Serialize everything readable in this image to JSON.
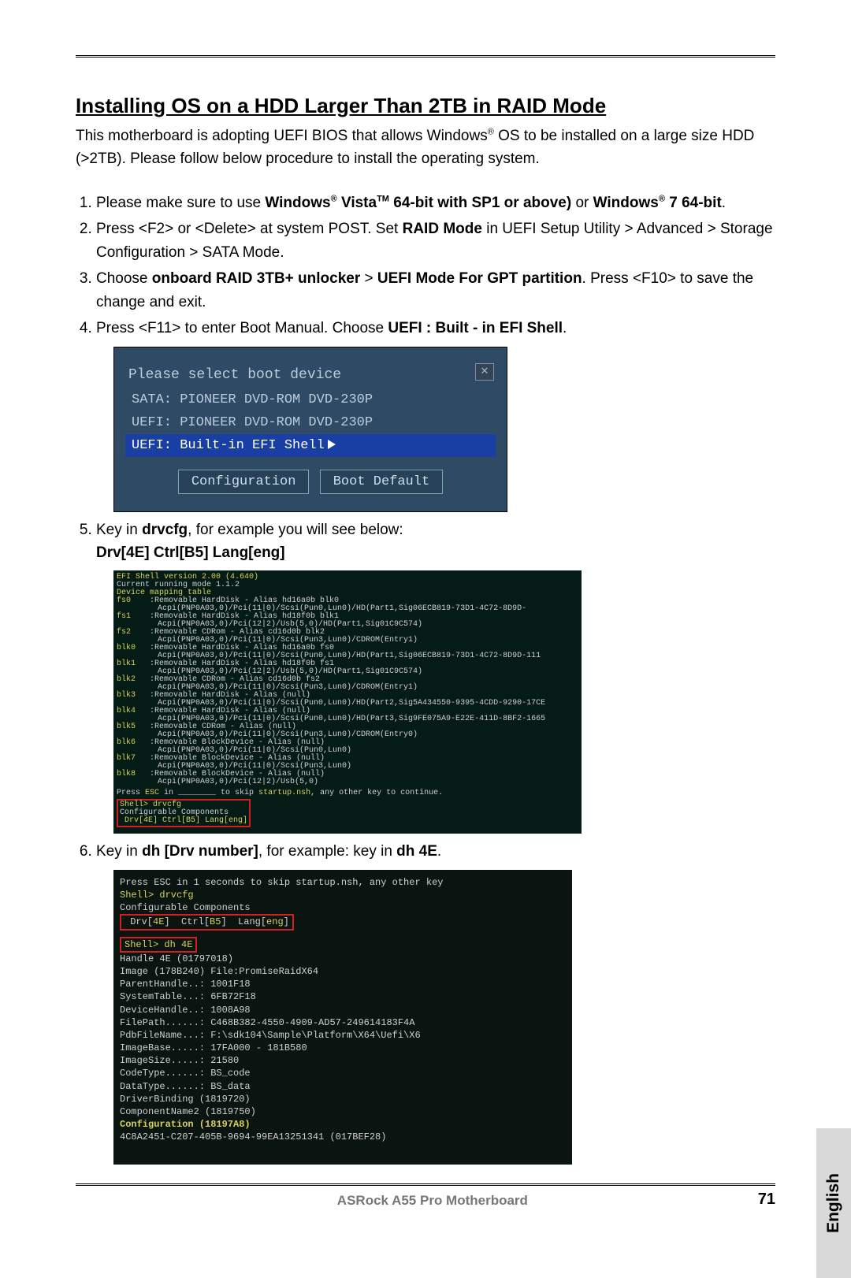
{
  "title": "Installing OS on a HDD Larger Than 2TB in RAID Mode",
  "intro": {
    "p1a": "This motherboard is adopting UEFI BIOS that allows Windows",
    "reg1": "®",
    "p1b": " OS to be installed on a large size HDD (>2TB). Please follow below procedure to install the operating system."
  },
  "steps": {
    "s1a": "Please make sure to use ",
    "s1b": "Windows",
    "reg2": "®",
    "s1c": " Vista",
    "tm": "TM",
    "s1d": " 64-bit with SP1 or above)",
    "s1e": " or ",
    "s1f": "Windows",
    "reg3": "®",
    "s1g": " 7 64-bit",
    "s1h": ".",
    "s2a": "Press <F2> or <Delete> at system POST. Set ",
    "s2b": "RAID Mode",
    "s2c": " in UEFI Setup Utility > Advanced > Storage Configuration > SATA Mode.",
    "s3a": "Choose ",
    "s3b": "onboard RAID 3TB+ unlocker",
    "s3c": " > ",
    "s3d": "UEFI Mode For GPT partition",
    "s3e": ". Press <F10> to save the change and exit.",
    "s4a": "Press <F11> to enter Boot Manual. Choose ",
    "s4b": "UEFI : Built - in EFI Shell",
    "s4c": ".",
    "s5a": "Key in ",
    "s5b": "drvcfg",
    "s5c": ", for example you will see below:",
    "s5d": "Drv[4E]   Ctrl[B5]   Lang[eng]",
    "s6a": "Key in ",
    "s6b": "dh [Drv number]",
    "s6c": ", for example: key in ",
    "s6d": "dh 4E",
    "s6e": "."
  },
  "fig1": {
    "header": "Please select boot device",
    "i1": "SATA: PIONEER DVD-ROM DVD-230P",
    "i2": "UEFI: PIONEER DVD-ROM DVD-230P",
    "i3": "UEFI: Built-in EFI Shell",
    "b1": "Configuration",
    "b2": "Boot Default",
    "close": "✕"
  },
  "fig2": {
    "ver": "EFI Shell version 2.00 (4.640)",
    "run": "Current running mode 1.1.2",
    "map": "Device mapping table",
    "rows": [
      {
        "k": "fs0",
        "v": ":Removable HardDisk - Alias hd16a0b blk0",
        "p": "Acpi(PNP0A03,0)/Pci(11|0)/Scsi(Pun0,Lun0)/HD(Part1,Sig06ECB819-73D1-4C72-8D9D-"
      },
      {
        "k": "fs1",
        "v": ":Removable HardDisk - Alias hd18f0b blk1",
        "p": "Acpi(PNP0A03,0)/Pci(12|2)/Usb(5,0)/HD(Part1,Sig01C9C574)"
      },
      {
        "k": "fs2",
        "v": ":Removable CDRom - Alias cd16d0b blk2",
        "p": "Acpi(PNP0A03,0)/Pci(11|0)/Scsi(Pun3,Lun0)/CDROM(Entry1)"
      },
      {
        "k": "blk0",
        "v": ":Removable HardDisk - Alias hd16a0b fs0",
        "p": "Acpi(PNP0A03,0)/Pci(11|0)/Scsi(Pun0,Lun0)/HD(Part1,Sig06ECB819-73D1-4C72-8D9D-111"
      },
      {
        "k": "blk1",
        "v": ":Removable HardDisk - Alias hd18f0b fs1",
        "p": "Acpi(PNP0A03,0)/Pci(12|2)/Usb(5,0)/HD(Part1,Sig01C9C574)"
      },
      {
        "k": "blk2",
        "v": ":Removable CDRom - Alias cd16d0b fs2",
        "p": "Acpi(PNP0A03,0)/Pci(11|0)/Scsi(Pun3,Lun0)/CDROM(Entry1)"
      },
      {
        "k": "blk3",
        "v": ":Removable HardDisk - Alias (null)",
        "p": "Acpi(PNP0A03,0)/Pci(11|0)/Scsi(Pun0,Lun0)/HD(Part2,Sig5A434550-9395-4CDD-9290-17CE"
      },
      {
        "k": "blk4",
        "v": ":Removable HardDisk - Alias (null)",
        "p": "Acpi(PNP0A03,0)/Pci(11|0)/Scsi(Pun0,Lun0)/HD(Part3,Sig9FE075A9-E22E-411D-8BF2-1665"
      },
      {
        "k": "blk5",
        "v": ":Removable CDRom - Alias (null)",
        "p": "Acpi(PNP0A03,0)/Pci(11|0)/Scsi(Pun3,Lun0)/CDROM(Entry0)"
      },
      {
        "k": "blk6",
        "v": ":Removable BlockDevice - Alias (null)",
        "p": "Acpi(PNP0A03,0)/Pci(11|0)/Scsi(Pun0,Lun0)"
      },
      {
        "k": "blk7",
        "v": ":Removable BlockDevice - Alias (null)",
        "p": "Acpi(PNP0A03,0)/Pci(11|0)/Scsi(Pun3,Lun0)"
      },
      {
        "k": "blk8",
        "v": ":Removable BlockDevice - Alias (null)",
        "p": "Acpi(PNP0A03,0)/Pci(12|2)/Usb(5,0)"
      }
    ],
    "press": "Press ESC in ________ to skip startup.nsh, any other key to continue.",
    "shell": "Shell> drvcfg",
    "comp": "Configurable Components",
    "res": "Drv[4E]  Ctrl[B5]  Lang[eng]"
  },
  "fig3": {
    "l0": "Press ESC in 1 seconds to skip startup.nsh, any other key",
    "l1": "Shell> drvcfg",
    "l2": "Configurable Components",
    "l3": " Drv[4E]  Ctrl[B5]  Lang[eng]",
    "l4": "Shell> dh 4E",
    "l5": "Handle 4E (01797018)",
    "l6": "   Image (178B240)    File:PromiseRaidX64",
    "l7": "     ParentHandle..: 1001F18",
    "l8": "     SystemTable...: 6FB72F18",
    "l9": "     DeviceHandle..: 1008A98",
    "l10": "     FilePath......: C468B382-4550-4909-AD57-249614183F4A",
    "l11": "     PdbFileName...: F:\\sdk104\\Sample\\Platform\\X64\\Uefi\\X6",
    "l12": "     ImageBase.....: 17FA000 - 181B580",
    "l13": "     ImageSize.....: 21580",
    "l14": "     CodeType......: BS_code",
    "l15": "     DataType......: BS_data",
    "l16": "   DriverBinding (1819720)",
    "l17": "   ComponentName2 (1819750)",
    "l18": "   Configuration (18197A8)",
    "l19": "   4C8A2451-C207-405B-9694-99EA13251341 (017BEF28)"
  },
  "tab": "English",
  "footer": {
    "product": "ASRock  A55 Pro  Motherboard",
    "page": "71"
  }
}
